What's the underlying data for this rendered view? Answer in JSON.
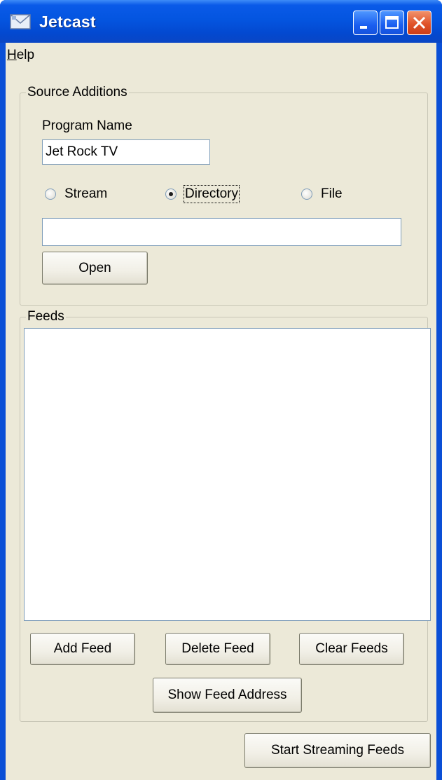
{
  "window": {
    "title": "Jetcast",
    "icon": "envelope-icon",
    "controls": [
      "minimize-icon",
      "maximize-icon",
      "close-icon"
    ]
  },
  "menu": {
    "help_label": "Help",
    "help_accel": "H",
    "help_rest": "elp"
  },
  "source_additions": {
    "legend": "Source Additions",
    "program_name_label": "Program Name",
    "program_name_value": "Jet Rock TV",
    "radio_options": [
      {
        "label": "Stream",
        "checked": false
      },
      {
        "label": "Directory",
        "checked": true
      },
      {
        "label": "File",
        "checked": false
      }
    ],
    "path_value": "",
    "open_label": "Open"
  },
  "feeds": {
    "legend": "Feeds",
    "items": [],
    "add_label": "Add Feed",
    "delete_label": "Delete Feed",
    "clear_label": "Clear Feeds",
    "show_address_label": "Show Feed Address"
  },
  "start_label": "Start Streaming Feeds"
}
